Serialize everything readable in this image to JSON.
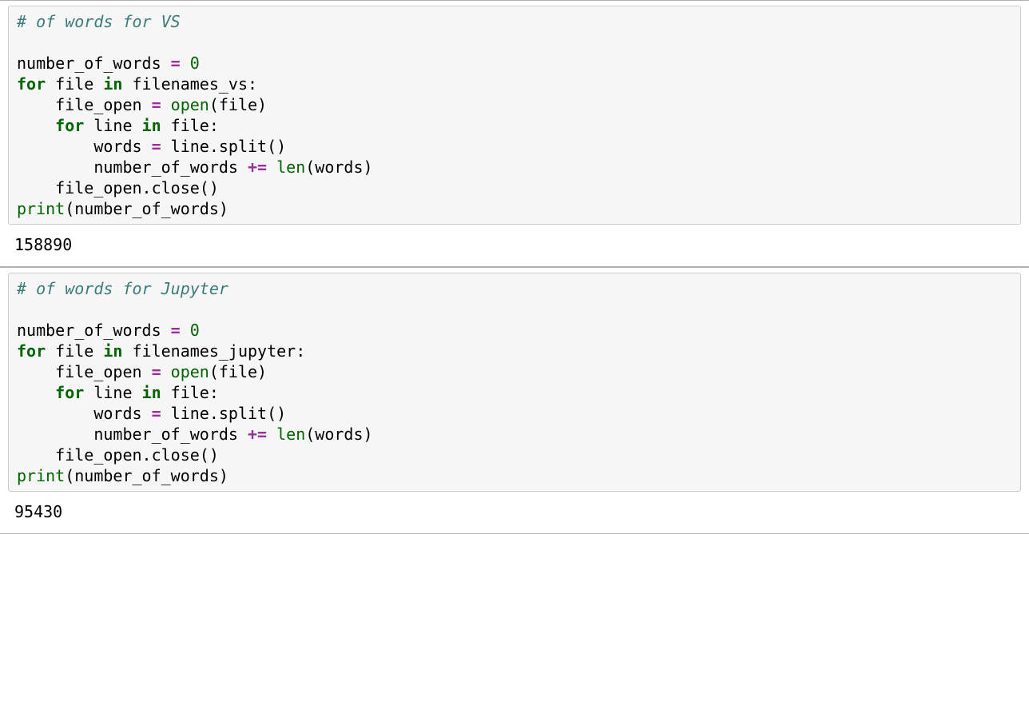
{
  "cells": [
    {
      "code": {
        "comment1": "# of words for VS",
        "line3_a": "number_of_words ",
        "line3_op": "=",
        "line3_b": " ",
        "line3_num": "0",
        "line4_kw1": "for",
        "line4_a": " file ",
        "line4_kw2": "in",
        "line4_b": " filenames_vs:",
        "line5_a": "    file_open ",
        "line5_op": "=",
        "line5_b": " ",
        "line5_fn": "open",
        "line5_c": "(file)",
        "line6_a": "    ",
        "line6_kw1": "for",
        "line6_b": " line ",
        "line6_kw2": "in",
        "line6_c": " file:",
        "line7_a": "        words ",
        "line7_op": "=",
        "line7_b": " line.split()",
        "line8_a": "        number_of_words ",
        "line8_op": "+=",
        "line8_b": " ",
        "line8_fn": "len",
        "line8_c": "(words)",
        "line9": "    file_open.close()",
        "line10_fn": "print",
        "line10_a": "(number_of_words)"
      },
      "output": "158890"
    },
    {
      "code": {
        "comment1": "# of words for Jupyter",
        "line3_a": "number_of_words ",
        "line3_op": "=",
        "line3_b": " ",
        "line3_num": "0",
        "line4_kw1": "for",
        "line4_a": " file ",
        "line4_kw2": "in",
        "line4_b": " filenames_jupyter:",
        "line5_a": "    file_open ",
        "line5_op": "=",
        "line5_b": " ",
        "line5_fn": "open",
        "line5_c": "(file)",
        "line6_a": "    ",
        "line6_kw1": "for",
        "line6_b": " line ",
        "line6_kw2": "in",
        "line6_c": " file:",
        "line7_a": "        words ",
        "line7_op": "=",
        "line7_b": " line.split()",
        "line8_a": "        number_of_words ",
        "line8_op": "+=",
        "line8_b": " ",
        "line8_fn": "len",
        "line8_c": "(words)",
        "line9": "    file_open.close()",
        "line10_fn": "print",
        "line10_a": "(number_of_words)"
      },
      "output": "95430"
    }
  ]
}
